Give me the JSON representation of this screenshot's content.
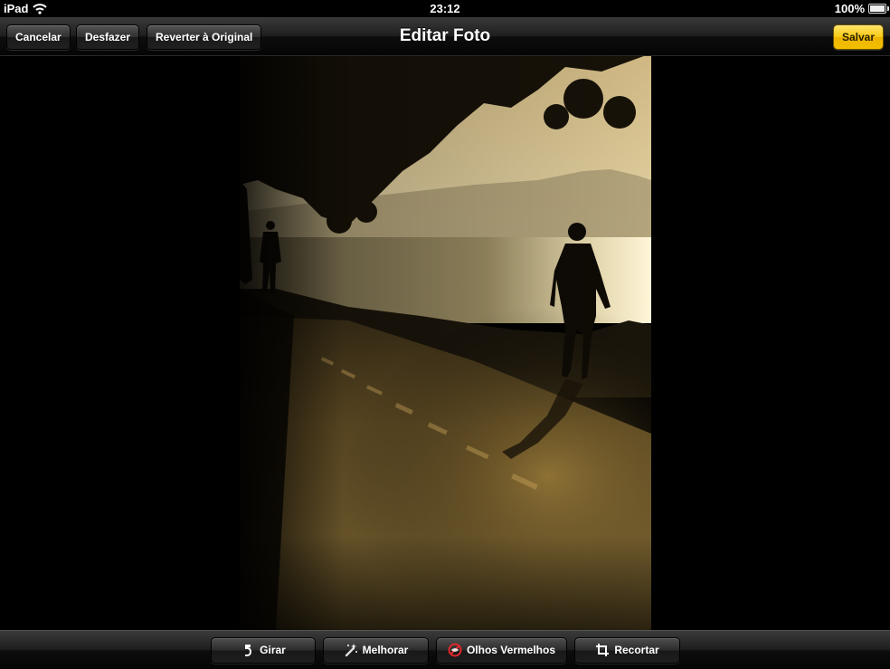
{
  "status_bar": {
    "carrier": "iPad",
    "time": "23:12",
    "battery": "100%"
  },
  "nav": {
    "title": "Editar Foto",
    "cancel_label": "Cancelar",
    "undo_label": "Desfazer",
    "revert_label": "Reverter à Original",
    "save_label": "Salvar"
  },
  "toolbar": {
    "rotate_label": "Girar",
    "enhance_label": "Melhorar",
    "redeye_label": "Olhos Vermelhos",
    "crop_label": "Recortar"
  },
  "icons": {
    "wifi": "wifi-icon",
    "battery": "battery-icon",
    "rotate": "rotate-icon",
    "enhance": "magic-wand-icon",
    "redeye": "red-eye-icon",
    "crop": "crop-icon"
  },
  "colors": {
    "save_button": "#f8c912",
    "redeye_icon": "#e0282c"
  }
}
